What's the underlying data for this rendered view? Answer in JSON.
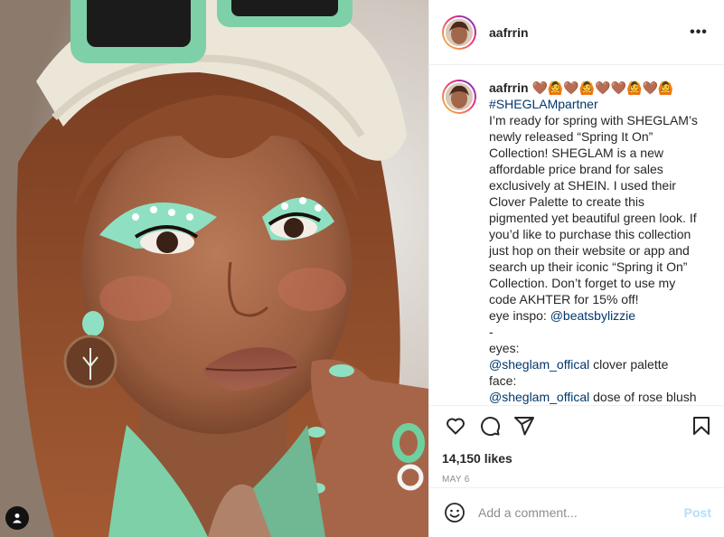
{
  "post": {
    "username": "aafrrin",
    "more_label": "•••",
    "caption": {
      "username": "aafrrin",
      "emoji": "🤎🙆🤎🙆🤎🤎🙆🤎🙆",
      "hashtag": "#SHEGLAMpartner",
      "body": "I’m ready for spring with SHEGLAM’s newly released “Spring It On” Collection! SHEGLAM is a new affordable price brand for sales exclusively at SHEIN. I used their Clover Palette to create this pigmented yet beautiful green look. If you’d like to purchase this collection just hop on their website or app and search up their iconic “Spring it On” Collection. Don’t forget to use my code AKHTER for 15% off!",
      "inspo_label": "eye inspo:",
      "inspo_mention": "@beatsbylizzie",
      "dash": "-",
      "eyes_label": "eyes:",
      "eyes_mention": "@sheglam_offical",
      "eyes_product": " clover palette",
      "face_label": "face:",
      "face_mention": "@sheglam_offical",
      "face_product": " dose of rose blush"
    },
    "likes": "14,150 likes",
    "date": "MAY 6",
    "comment_placeholder": "Add a comment...",
    "post_label": "Post"
  },
  "colors": {
    "link": "#00376b",
    "muted": "#8e8e8e",
    "post_button": "#b2dffc",
    "border": "#efefef"
  },
  "icons": {
    "like": "heart-icon",
    "comment": "comment-icon",
    "share": "paper-plane-icon",
    "save": "bookmark-icon",
    "more": "more-horizontal-icon",
    "emoji": "smiley-icon",
    "user_tag": "user-tag-icon"
  }
}
